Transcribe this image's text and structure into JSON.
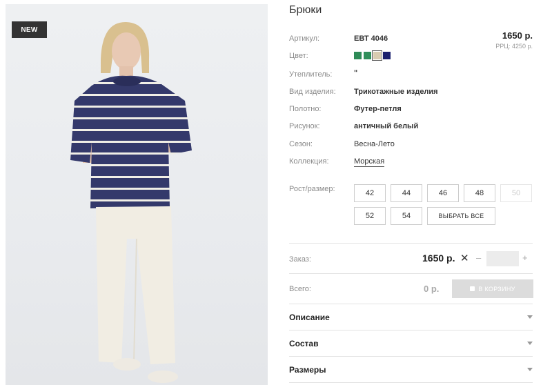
{
  "product": {
    "badge": "NEW",
    "title": "Брюки",
    "price": "1650 р.",
    "rrp": "РРЦ: 4250 р."
  },
  "attributes": [
    {
      "label": "Артикул:",
      "value": "ЕВТ 4046"
    },
    {
      "label": "Цвет:",
      "value": ""
    },
    {
      "label": "Утеплитель:",
      "value": "\""
    },
    {
      "label": "Вид изделия:",
      "value": "Трикотажные изделия"
    },
    {
      "label": "Полотно:",
      "value": "Футер-петля"
    },
    {
      "label": "Рисунок:",
      "value": "античный белый"
    },
    {
      "label": "Сезон:",
      "value": "Весна-Лето"
    },
    {
      "label": "Коллекция:",
      "value": "Морская"
    }
  ],
  "colors": [
    {
      "name": "green",
      "hex": "#2e8b57",
      "selected": false
    },
    {
      "name": "green-2",
      "hex": "#2f8f5a",
      "selected": false
    },
    {
      "name": "beige",
      "hex": "#d8cbb0",
      "selected": true
    },
    {
      "name": "navy",
      "hex": "#1a1f6e",
      "selected": false
    }
  ],
  "sizes": {
    "label": "Рост/размер:",
    "options": [
      {
        "value": "42",
        "available": true
      },
      {
        "value": "44",
        "available": true
      },
      {
        "value": "46",
        "available": true
      },
      {
        "value": "48",
        "available": true
      },
      {
        "value": "50",
        "available": false
      },
      {
        "value": "52",
        "available": true
      },
      {
        "value": "54",
        "available": true
      }
    ],
    "select_all": "ВЫБРАТЬ ВСЕ"
  },
  "order": {
    "label": "Заказ:",
    "price": "1650 р.",
    "times": "✕",
    "minus": "–",
    "plus": "+",
    "quantity": ""
  },
  "total": {
    "label": "Всего:",
    "value": "0 р.",
    "cart_button": "В КОРЗИНУ"
  },
  "accordion": [
    {
      "title": "Описание"
    },
    {
      "title": "Состав"
    },
    {
      "title": "Размеры"
    }
  ]
}
